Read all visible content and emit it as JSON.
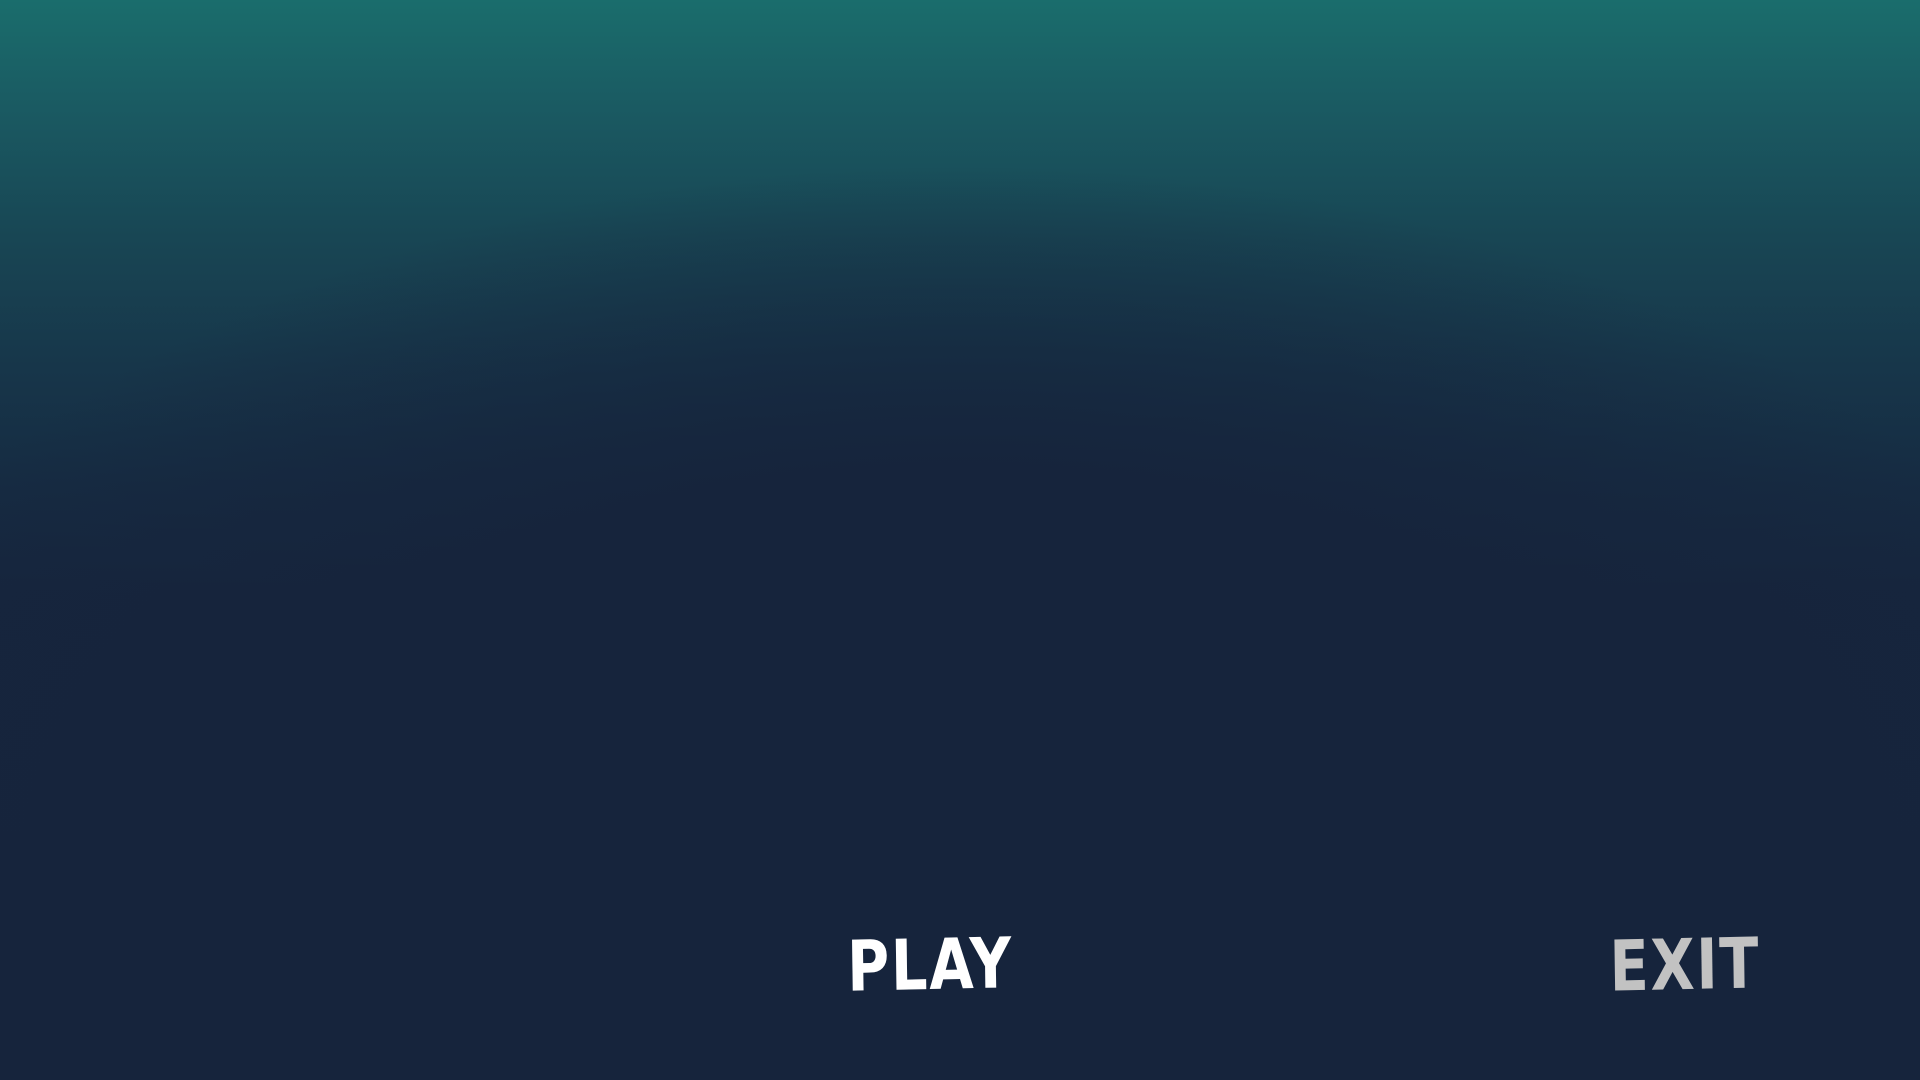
{
  "menu": {
    "play_label": "PLAY",
    "exit_label": "EXIT"
  },
  "colors": {
    "background_top": "#1a6d6c",
    "background_bottom": "#16243c",
    "play_text": "#ffffff",
    "exit_text": "#c2c2c2"
  }
}
